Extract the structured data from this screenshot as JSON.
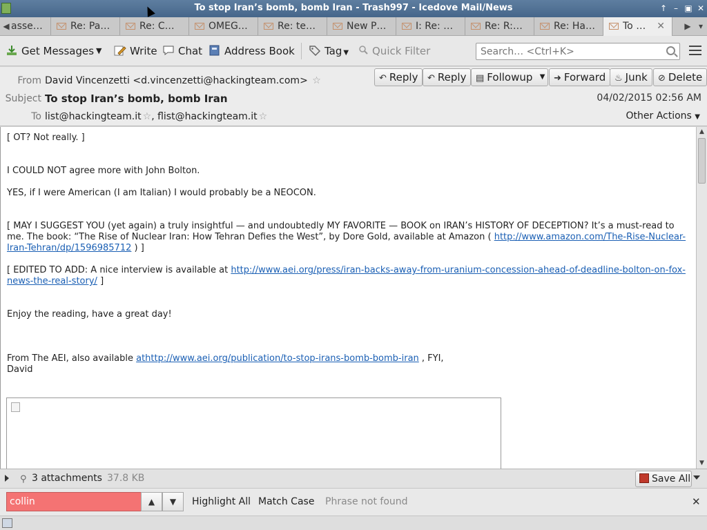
{
  "window": {
    "title": "To stop Iran’s bomb, bomb Iran - Trash997 - Icedove Mail/News",
    "controls": [
      "↑",
      "–",
      "▣",
      "✕"
    ]
  },
  "tabs": {
    "scroll_left": "◀",
    "scroll_right": "▶",
    "list_all": "▾",
    "items": [
      {
        "label": "asse…",
        "kind": "message"
      },
      {
        "label": "Re: Pa…",
        "kind": "message"
      },
      {
        "label": "Re: C…",
        "kind": "message"
      },
      {
        "label": "OMEG…",
        "kind": "message"
      },
      {
        "label": "Re: te…",
        "kind": "message"
      },
      {
        "label": "New P…",
        "kind": "message"
      },
      {
        "label": "I: Re: …",
        "kind": "message"
      },
      {
        "label": "Re: R:…",
        "kind": "message"
      },
      {
        "label": "Re: Ha…",
        "kind": "message"
      },
      {
        "label": "To …",
        "kind": "message",
        "active": true
      }
    ],
    "close_glyph": "✕"
  },
  "toolbar": {
    "get_messages": "Get Messages",
    "write": "Write",
    "chat": "Chat",
    "address_book": "Address Book",
    "tag": "Tag",
    "quick_filter": "Quick Filter",
    "search_placeholder": "Search… <Ctrl+K>",
    "icons": [
      "download-icon",
      "pencil-icon",
      "chat-bubble-icon",
      "address-book-icon",
      "tag-icon",
      "filter-icon",
      "search-icon",
      "hamburger-menu-icon"
    ]
  },
  "header": {
    "from_label": "From",
    "from_value": "David Vincenzetti <d.vincenzetti@hackingteam.com>",
    "subject_label": "Subject",
    "subject_value": "To stop Iran’s bomb, bomb Iran",
    "to_label": "To",
    "to_value_1": "list@hackingteam.it",
    "to_value_2": "flist@hackingteam.it",
    "date": "04/02/2015 02:56 AM",
    "other_actions": "Other Actions",
    "buttons": {
      "reply": "Reply",
      "reply_all": "Reply",
      "followup": "Followup",
      "forward": "Forward",
      "junk": "Junk",
      "delete": "Delete"
    }
  },
  "message": {
    "line_ot": "[ OT? Not really. ]",
    "line_bolton": "I COULD NOT agree more with John Bolton.",
    "line_neocon": "YES, if I were American (I am Italian) I would probably be a NEOCON.",
    "suggest_text": "[ MAY I SUGGEST YOU (yet again) a truly insightful — and undoubtedly MY FAVORITE — BOOK on IRAN’s HISTORY OF DECEPTION?  It’s a must-read to me.  The book: “The Rise of Nuclear Iran: How Tehran Defies the West”, by Dore Gold, available at Amazon ( ",
    "suggest_link": "http://www.amazon.com/The-Rise-Nuclear-Iran-Tehran/dp/1596985712",
    "suggest_end": " ) ]",
    "edited_text": "[ EDITED TO ADD: A nice interview is available at ",
    "edited_link": "http://www.aei.org/press/iran-backs-away-from-uranium-concession-ahead-of-deadline-bolton-on-fox-news-the-real-story/",
    "edited_end": " ]",
    "enjoy": "Enjoy the reading, have a great day!",
    "from_aei_text": "From The AEI, also available ",
    "from_aei_link": "athttp://www.aei.org/publication/to-stop-irans-bomb-bomb-iran",
    "from_aei_end": "  , FYI,",
    "signature": "David"
  },
  "attachments": {
    "count_label": "3 attachments",
    "size": "37.8 KB",
    "save_all": "Save All"
  },
  "findbar": {
    "query": "collin",
    "highlight_all": "Highlight All",
    "match_case": "Match Case",
    "status": "Phrase not found"
  }
}
